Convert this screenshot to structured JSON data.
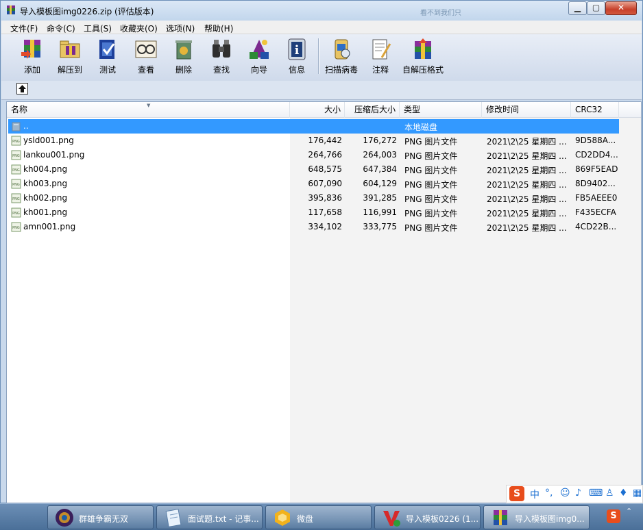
{
  "window": {
    "title": "导入模板图img0226.zip (评估版本)",
    "ghost_text": "看不到我们只"
  },
  "menu": [
    "文件(F)",
    "命令(C)",
    "工具(S)",
    "收藏夹(O)",
    "选项(N)",
    "帮助(H)"
  ],
  "toolbar": [
    {
      "label": "添加",
      "icon": "add-archive-icon"
    },
    {
      "label": "解压到",
      "icon": "extract-to-icon"
    },
    {
      "label": "测试",
      "icon": "test-icon"
    },
    {
      "label": "查看",
      "icon": "view-icon"
    },
    {
      "label": "删除",
      "icon": "delete-icon"
    },
    {
      "label": "查找",
      "icon": "find-icon"
    },
    {
      "label": "向导",
      "icon": "wizard-icon"
    },
    {
      "label": "信息",
      "icon": "info-icon"
    },
    {
      "label": "扫描病毒",
      "icon": "virus-scan-icon"
    },
    {
      "label": "注释",
      "icon": "comment-icon"
    },
    {
      "label": "自解压格式",
      "icon": "sfx-icon"
    }
  ],
  "columns": [
    "名称",
    "大小",
    "压缩后大小",
    "类型",
    "修改时间",
    "CRC32"
  ],
  "parent_row": {
    "name": "..",
    "type": "本地磁盘"
  },
  "files": [
    {
      "name": "ysld001.png",
      "size": "176,442",
      "packed": "176,272",
      "type": "PNG 图片文件",
      "modified": "2021\\2\\25 星期四 ...",
      "crc": "9D588A..."
    },
    {
      "name": "lankou001.png",
      "size": "264,766",
      "packed": "264,003",
      "type": "PNG 图片文件",
      "modified": "2021\\2\\25 星期四 ...",
      "crc": "CD2DD4..."
    },
    {
      "name": "kh004.png",
      "size": "648,575",
      "packed": "647,384",
      "type": "PNG 图片文件",
      "modified": "2021\\2\\25 星期四 ...",
      "crc": "869F5EAD"
    },
    {
      "name": "kh003.png",
      "size": "607,090",
      "packed": "604,129",
      "type": "PNG 图片文件",
      "modified": "2021\\2\\25 星期四 ...",
      "crc": "8D9402..."
    },
    {
      "name": "kh002.png",
      "size": "395,836",
      "packed": "391,285",
      "type": "PNG 图片文件",
      "modified": "2021\\2\\25 星期四 ...",
      "crc": "FB5AEEE0"
    },
    {
      "name": "kh001.png",
      "size": "117,658",
      "packed": "116,991",
      "type": "PNG 图片文件",
      "modified": "2021\\2\\25 星期四 ...",
      "crc": "F435ECFA"
    },
    {
      "name": "amn001.png",
      "size": "334,102",
      "packed": "333,775",
      "type": "PNG 图片文件",
      "modified": "2021\\2\\25 星期四 ...",
      "crc": "4CD22B..."
    }
  ],
  "taskbar": [
    {
      "label": "群雄争霸无双",
      "icon": "game-app-icon"
    },
    {
      "label": "面试题.txt - 记事...",
      "icon": "notepad-icon"
    },
    {
      "label": "微盘",
      "icon": "weipan-icon"
    },
    {
      "label": "导入模板0226 (1...",
      "icon": "vs-app-icon"
    },
    {
      "label": "导入模板图img0...",
      "icon": "winrar-icon"
    }
  ],
  "ime": {
    "lang": "中",
    "punct": "°,",
    "logo": "S"
  }
}
